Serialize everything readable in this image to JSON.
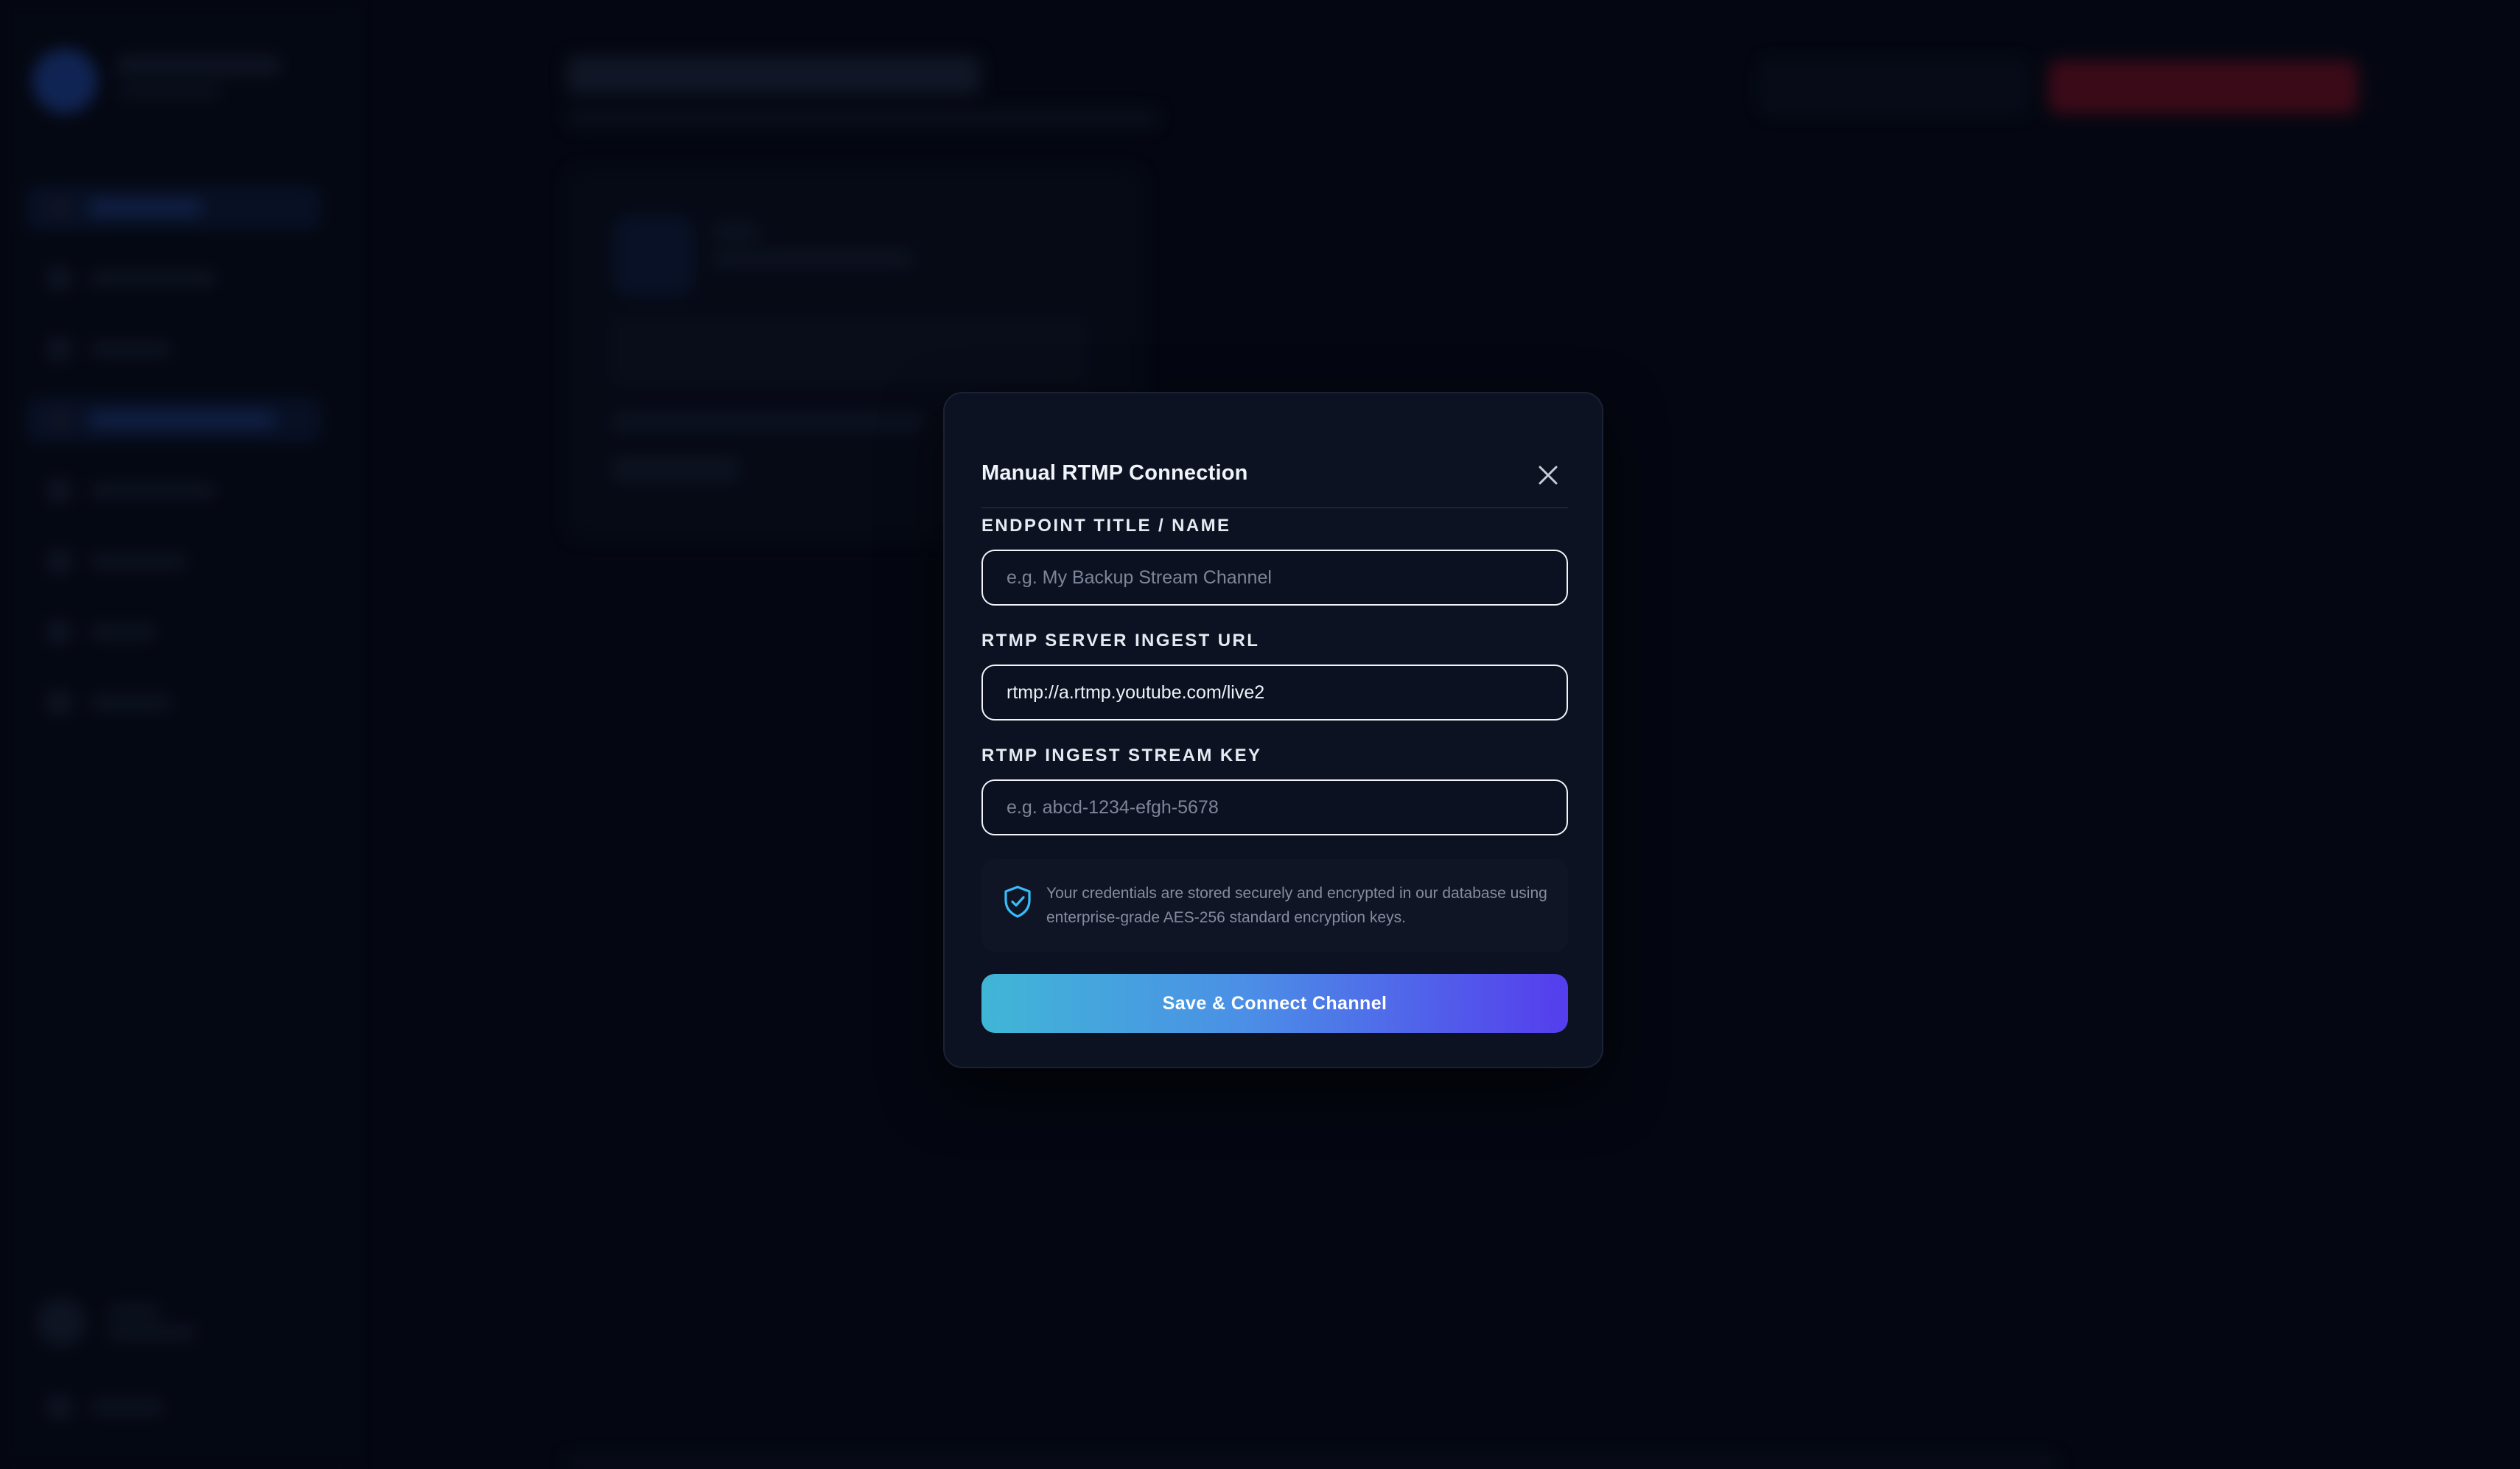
{
  "modal": {
    "title": "Manual RTMP Connection",
    "close_icon": "close-icon",
    "fields": {
      "title": {
        "label": "ENDPOINT TITLE / NAME",
        "value": "",
        "placeholder": "e.g. My Backup Stream Channel"
      },
      "url": {
        "label": "RTMP SERVER INGEST URL",
        "value": "rtmp://a.rtmp.youtube.com/live2",
        "placeholder": ""
      },
      "key": {
        "label": "RTMP INGEST STREAM KEY",
        "value": "",
        "placeholder": "e.g. abcd-1234-efgh-5678"
      }
    },
    "notice": {
      "icon": "shield-check-icon",
      "text": "Your credentials are stored securely and encrypted in our database using enterprise-grade AES-256 standard encryption keys."
    },
    "submit_label": "Save & Connect Channel"
  },
  "colors": {
    "accent_start": "#40b6d6",
    "accent_end": "#553ded",
    "shield": "#38bdf8",
    "danger": "#6b1024"
  }
}
